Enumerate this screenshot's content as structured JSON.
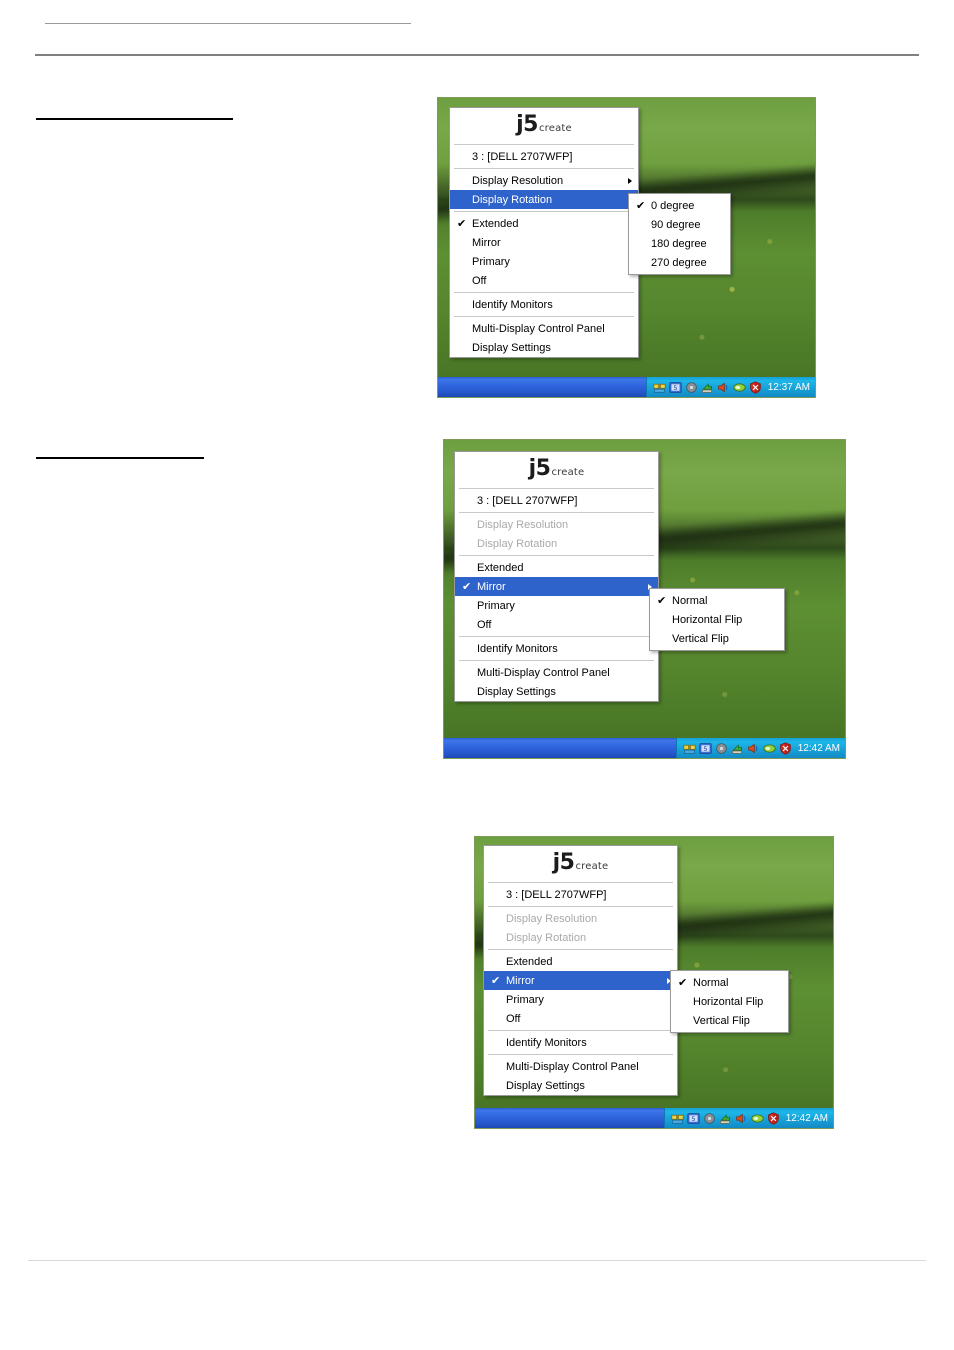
{
  "page": {
    "background": "#ffffff",
    "header_rule_color": "#808080",
    "footer_rule_color": "#d9d9d9",
    "heading_underline_color": "#000000"
  },
  "colors": {
    "menu_highlight": "#2f63cc",
    "menu_background": "#ffffff",
    "menu_border": "#9a9a9a",
    "disabled_text": "#a9a9a9",
    "taskbar_blue": "#2f64dd",
    "tray_blue": "#179fd6",
    "wallpaper_green": "#5d8f33"
  },
  "logo": {
    "mark": "j5",
    "word": "create"
  },
  "menu_common": {
    "monitor_label": "3 : [DELL 2707WFP]",
    "display_resolution": "Display Resolution",
    "display_rotation": "Display Rotation",
    "extended": "Extended",
    "mirror": "Mirror",
    "primary": "Primary",
    "off": "Off",
    "identify_monitors": "Identify Monitors",
    "multi_display_control_panel": "Multi-Display Control Panel",
    "display_settings": "Display Settings",
    "check_glyph": "✔"
  },
  "rotation_submenu": {
    "items": [
      {
        "label": "0 degree",
        "checked": true
      },
      {
        "label": "90 degree",
        "checked": false
      },
      {
        "label": "180 degree",
        "checked": false
      },
      {
        "label": "270 degree",
        "checked": false
      }
    ]
  },
  "mirror_submenu": {
    "items": [
      {
        "label": "Normal",
        "checked": true
      },
      {
        "label": "Horizontal Flip",
        "checked": false
      },
      {
        "label": "Vertical Flip",
        "checked": false
      }
    ]
  },
  "screenshots": [
    {
      "id": "shot-1",
      "clock": "12:37 AM",
      "highlighted_item": "Display Rotation",
      "checked_mode": "Extended",
      "resolution_enabled": true,
      "rotation_enabled": true,
      "open_submenu": "rotation"
    },
    {
      "id": "shot-2",
      "clock": "12:42 AM",
      "highlighted_item": "Mirror",
      "checked_mode": "Mirror",
      "resolution_enabled": false,
      "rotation_enabled": false,
      "open_submenu": "mirror"
    },
    {
      "id": "shot-3",
      "clock": "12:42 AM",
      "highlighted_item": "Mirror",
      "checked_mode": "Mirror",
      "resolution_enabled": false,
      "rotation_enabled": false,
      "open_submenu": "mirror"
    }
  ],
  "tray_icons": [
    "network-connection-icon",
    "display-adapter-icon",
    "volume-disk-icon",
    "green-arrow-update-icon",
    "speaker-volume-icon",
    "nvidia-settings-icon",
    "security-shield-alert-icon"
  ]
}
